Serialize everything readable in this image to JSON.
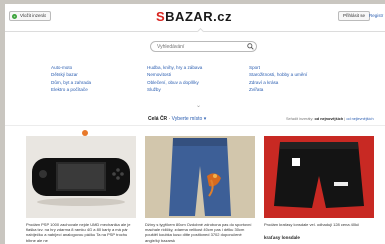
{
  "header": {
    "add_label": "Vložit inzerát",
    "logo_prefix": "S",
    "logo_rest": "BAZAR.cz",
    "login_label": "Přihlásit se",
    "register_label": "Registr"
  },
  "search": {
    "placeholder": "Vyhledávání"
  },
  "categories": {
    "col1": [
      "Auto-moto",
      "Dětský bazar",
      "Dům, byt a zahrada",
      "Elektro a počítače"
    ],
    "col2": [
      "Hudba, knihy, hry a zábava",
      "Nemovitosti",
      "Oblečení, obuv a doplňky",
      "Služby"
    ],
    "col3": [
      "Sport",
      "Starožitnosti, hobby a umění",
      "Zdraví a krása",
      "Zvířata"
    ]
  },
  "filter": {
    "region_label": "Celá ČR",
    "choose_place": "Vyberte místo",
    "sort_prefix": "Seřadit inzeráty:",
    "sort_active": "od nejnovějších",
    "sort_other": "od nejlevnějších"
  },
  "listings": [
    {
      "text": "Prodám PSP 1000 zachovale nejde UMD mechanika ale je flaška tzv. na hry zdarma 8 ramku 4G a 80 karty a má pár nabíječku a nabíjecí analogovou páčku Ta na PSP trochu blbne ale ne",
      "title": ""
    },
    {
      "text": "Džíny s tygříkem 80cm Ozdobné zdrobona pas do sportovní machale ridičky, zdarma velikost 40cm pas i délku 30cm pouštěl koubka kuso ditte positioned 3702 doporučené angle/ký bazarsk",
      "title": ""
    },
    {
      "text": "Prodám kraťasy lonsdale vel. odhaduji 128 cena 40kč",
      "title": "kraťasy lonsdale"
    }
  ]
}
